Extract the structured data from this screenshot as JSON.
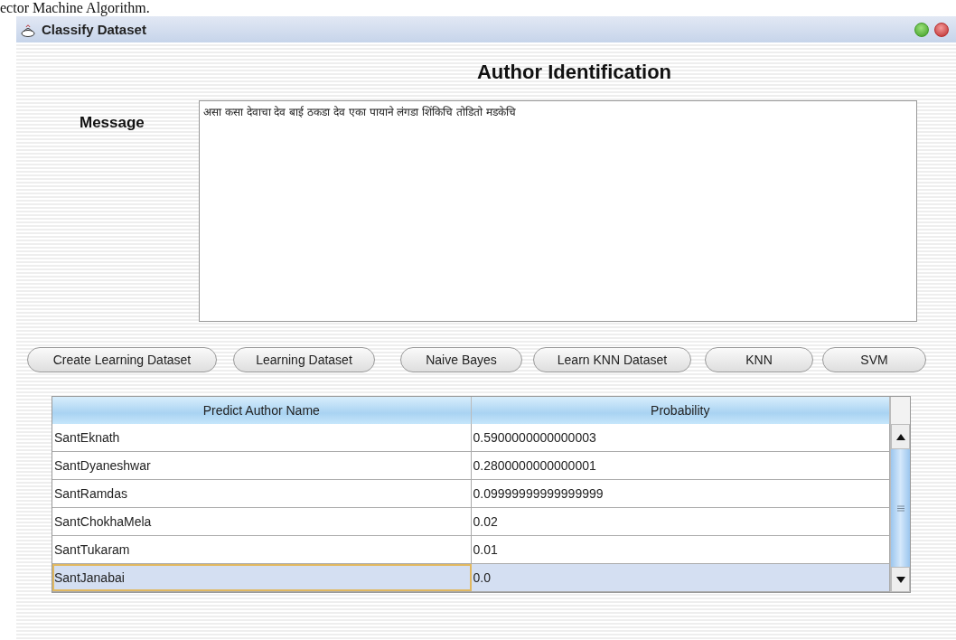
{
  "document_caption": "ector Machine Algorithm.",
  "window": {
    "title": "Classify Dataset"
  },
  "heading": "Author Identification",
  "message": {
    "label": "Message",
    "value": "असा कसा देवाचा देव बाई ठकडा देव एका पायाने लंगडा शिंकिचि तोडितो मडकेचि"
  },
  "buttons": [
    "Create Learning Dataset",
    "Learning Dataset",
    "Naive Bayes",
    "Learn KNN Dataset",
    "KNN",
    "SVM"
  ],
  "table": {
    "columns": [
      "Predict Author Name",
      "Probability"
    ],
    "rows": [
      {
        "cells": [
          "SantEknath",
          "0.5900000000000003"
        ],
        "selected": false
      },
      {
        "cells": [
          "SantDyaneshwar",
          "0.2800000000000001"
        ],
        "selected": false
      },
      {
        "cells": [
          "SantRamdas",
          "0.09999999999999999"
        ],
        "selected": false
      },
      {
        "cells": [
          "SantChokhaMela",
          "0.02"
        ],
        "selected": false
      },
      {
        "cells": [
          "SantTukaram",
          "0.01"
        ],
        "selected": false
      },
      {
        "cells": [
          "SantJanabai",
          "0.0"
        ],
        "selected": true
      }
    ]
  }
}
